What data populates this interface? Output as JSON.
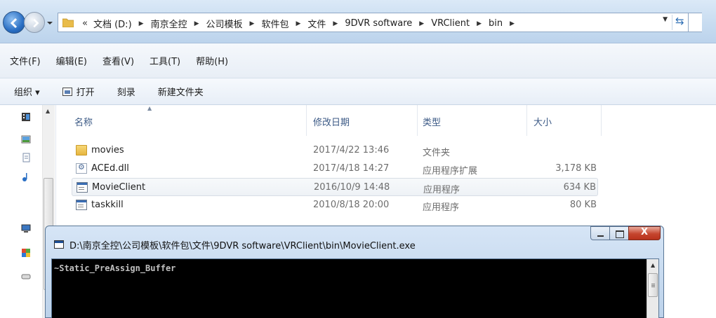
{
  "address_bar": {
    "overflow": "«",
    "crumbs": [
      "文档 (D:)",
      "南京全控",
      "公司模板",
      "软件包",
      "文件",
      "9DVR  software",
      "VRClient",
      "bin"
    ]
  },
  "menu": [
    "文件(F)",
    "编辑(E)",
    "查看(V)",
    "工具(T)",
    "帮助(H)"
  ],
  "toolbar": {
    "organize": "组织 ▾",
    "open": "打开",
    "burn": "刻录",
    "new_folder": "新建文件夹"
  },
  "columns": {
    "name": "名称",
    "date": "修改日期",
    "type": "类型",
    "size": "大小"
  },
  "files": [
    {
      "name": "movies",
      "date": "2017/4/22 13:46",
      "type": "文件夹",
      "size": "",
      "icon": "folder-icon"
    },
    {
      "name": "ACEd.dll",
      "date": "2017/4/18 14:27",
      "type": "应用程序扩展",
      "size": "3,178 KB",
      "icon": "dll-icon"
    },
    {
      "name": "MovieClient",
      "date": "2016/10/9 14:48",
      "type": "应用程序",
      "size": "634 KB",
      "icon": "exe-icon",
      "selected": true
    },
    {
      "name": "taskkill",
      "date": "2010/8/18 20:00",
      "type": "应用程序",
      "size": "80 KB",
      "icon": "exe-icon"
    }
  ],
  "console": {
    "title": "D:\\南京全控\\公司模板\\软件包\\文件\\9DVR  software\\VRClient\\bin\\MovieClient.exe",
    "output": "~Static_PreAssign_Buffer",
    "close_label": "X"
  }
}
